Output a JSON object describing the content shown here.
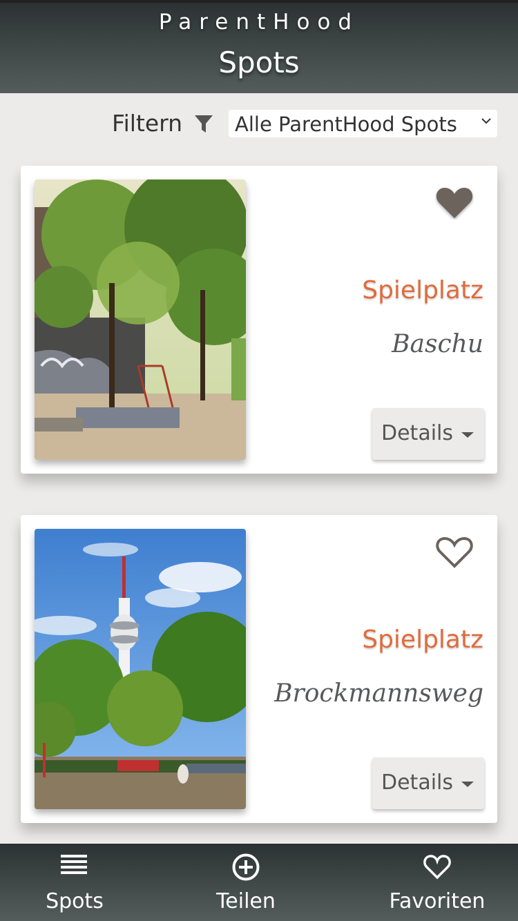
{
  "header": {
    "brand": "ParentHood",
    "title": "Spots"
  },
  "filter": {
    "label": "Filtern",
    "selected": "Alle ParentHood Spots"
  },
  "spots": [
    {
      "category": "Spielplatz",
      "name": "Baschu",
      "details_label": "Details",
      "favorite": true,
      "photo": "playground-graffiti-trees-photo"
    },
    {
      "category": "Spielplatz",
      "name": "Brockmannsweg",
      "details_label": "Details",
      "favorite": false,
      "photo": "tv-tower-park-photo"
    }
  ],
  "tabbar": {
    "items": [
      {
        "label": "Spots",
        "icon": "list-icon"
      },
      {
        "label": "Teilen",
        "icon": "plus-circle-icon"
      },
      {
        "label": "Favoriten",
        "icon": "heart-outline-icon"
      }
    ]
  },
  "colors": {
    "accent": "#e06b3c",
    "header": "#3e4647",
    "heart": "#6b635c"
  }
}
